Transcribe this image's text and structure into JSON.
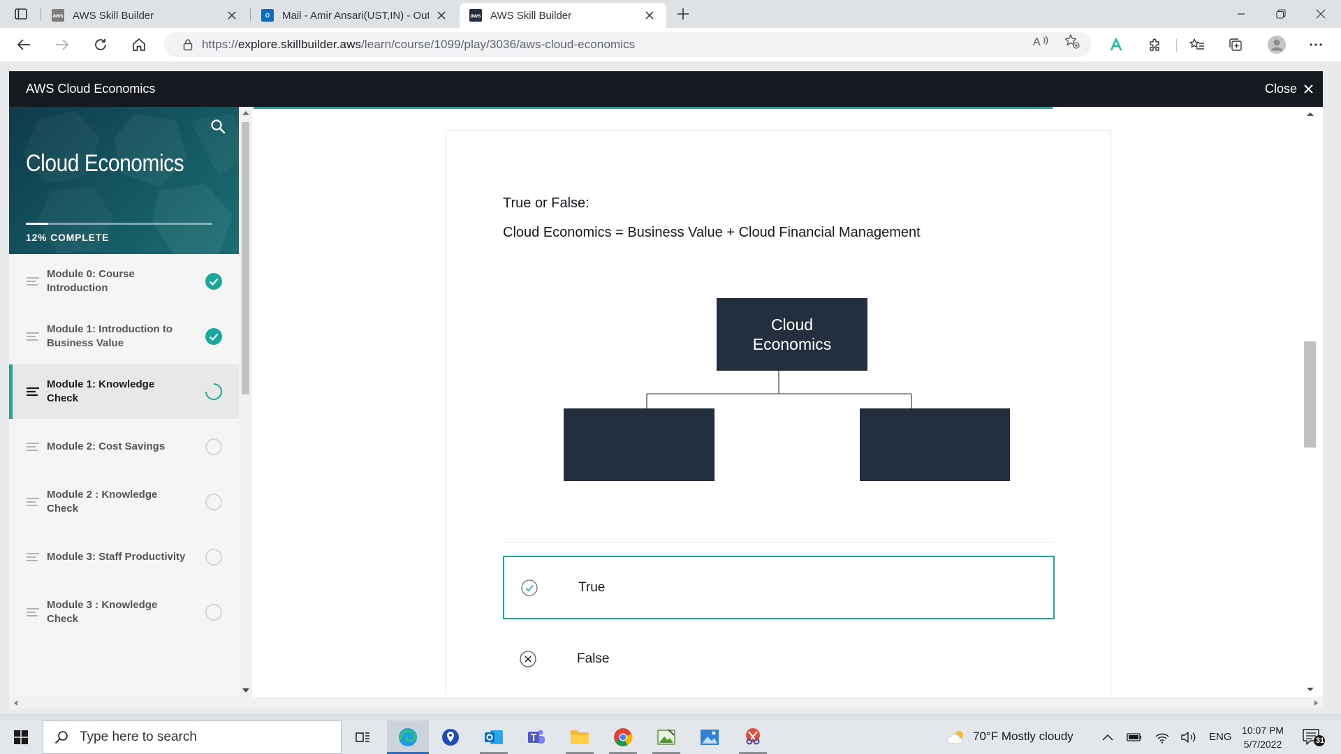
{
  "browser": {
    "tabs": [
      {
        "title": "AWS Skill Builder",
        "favicon": "aws-favicon",
        "active": false
      },
      {
        "title": "Mail - Amir Ansari(UST,IN) - Outl",
        "favicon": "outlook-favicon",
        "active": false
      },
      {
        "title": "AWS Skill Builder",
        "favicon": "aws-favicon",
        "active": true
      }
    ],
    "url_prefix": "https://",
    "url_host": "explore.skillbuilder.aws",
    "url_path": "/learn/course/1099/play/3036/aws-cloud-economics"
  },
  "course": {
    "header_title": "AWS Cloud Economics",
    "close_label": "Close",
    "sidebar_title": "Cloud Economics",
    "progress_percent": 12,
    "progress_label": "12% COMPLETE"
  },
  "lessons": [
    {
      "label": "Module 0: Course Introduction",
      "status": "complete"
    },
    {
      "label": "Module 1: Introduction to Business Value",
      "status": "complete"
    },
    {
      "label": "Module 1: Knowledge Check",
      "status": "in-progress"
    },
    {
      "label": "Module 2: Cost Savings",
      "status": "not-started"
    },
    {
      "label": "Module 2 : Knowledge Check",
      "status": "not-started"
    },
    {
      "label": "Module 3: Staff Productivity",
      "status": "not-started"
    },
    {
      "label": "Module 3 : Knowledge Check",
      "status": "not-started"
    }
  ],
  "question": {
    "kicker": "True or False:",
    "text": "Cloud Economics = Business Value + Cloud Financial Management",
    "diagram_root_label": "Cloud\nEconomics",
    "choices": [
      {
        "label": "True",
        "icon": "check-circle-icon",
        "selected": true
      },
      {
        "label": "False",
        "icon": "x-circle-icon",
        "selected": false
      }
    ]
  },
  "taskbar": {
    "search_placeholder": "Type here to search",
    "weather": "70°F  Mostly cloudy",
    "language": "ENG",
    "time": "10:07 PM",
    "date": "5/7/2022",
    "notification_count": "31"
  },
  "colors": {
    "accent": "#1aa89c",
    "header_bg": "#16191f",
    "diagram_node": "#232f3e"
  }
}
